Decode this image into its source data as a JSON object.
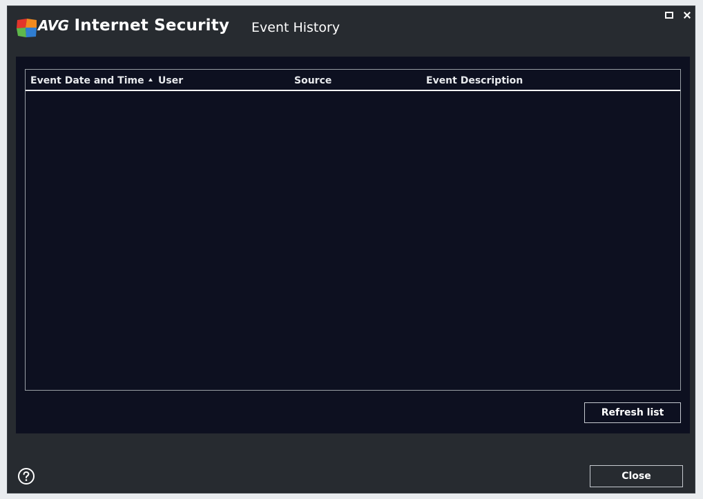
{
  "window": {
    "brand_short": "AVG",
    "product_name": "Internet Security",
    "dialog_title": "Event History"
  },
  "table": {
    "columns": [
      {
        "label": "Event Date and Time"
      },
      {
        "label": "User",
        "sorted": "ascending"
      },
      {
        "label": "Source"
      },
      {
        "label": "Event Description"
      }
    ],
    "rows": []
  },
  "buttons": {
    "refresh_label": "Refresh list",
    "close_label": "Close"
  },
  "colors": {
    "window_bg": "#272b30",
    "panel_bg": "#0d1020",
    "text": "#ffffff",
    "logo_red": "#e2352b",
    "logo_orange": "#f18a1f",
    "logo_green": "#5fb84b",
    "logo_blue": "#2f7dd1"
  },
  "icons": {
    "logo": "avg-logo-icon",
    "maximize": "maximize-icon",
    "close": "close-icon",
    "help": "help-icon",
    "sort": "sort-ascending-icon"
  }
}
